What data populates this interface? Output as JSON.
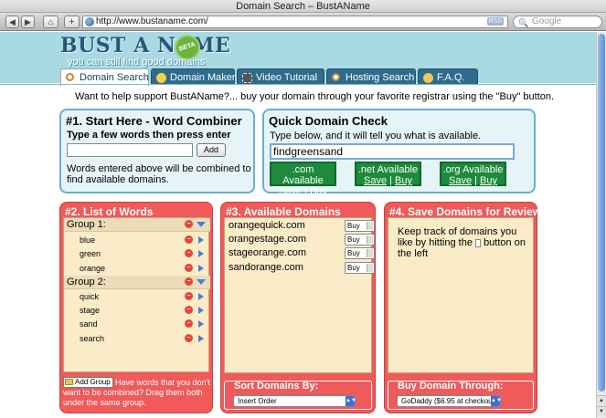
{
  "window": {
    "title": "Domain Search – BustAName"
  },
  "browser": {
    "url": "http://www.bustaname.com/",
    "rss_label": "RSS",
    "search_placeholder": "Google"
  },
  "site": {
    "logo_title": "BUST A NAME",
    "logo_badge": "BETA",
    "tagline": "you can still find good domains"
  },
  "tabs": [
    {
      "label": "Domain Search",
      "active": true,
      "icon": "magnifier-icon"
    },
    {
      "label": "Domain Maker",
      "active": false,
      "icon": "lightbulb-icon"
    },
    {
      "label": "Video Tutorial",
      "active": false,
      "icon": "film-icon"
    },
    {
      "label": "Hosting Search",
      "active": false,
      "icon": "magnifier-icon"
    },
    {
      "label": "F.A.Q.",
      "active": false,
      "icon": "help-icon"
    }
  ],
  "support_text": "Want to help support BustAName?... buy your domain through your favorite registrar using the \"Buy\" button.",
  "combiner": {
    "title": "#1. Start Here - Word Combiner",
    "subtitle": "Type a few words then press enter",
    "input_value": "",
    "add_label": "Add",
    "note": "Words entered above will be combined to find available domains."
  },
  "quick_check": {
    "title": "Quick Domain Check",
    "subtitle": "Type below, and it will tell you what is available.",
    "input_value": "findgreensand",
    "results": [
      {
        "label": ".com Available",
        "save": "Save",
        "sep": "|",
        "buy": "Buy"
      },
      {
        "label": ".net Available",
        "save": "Save",
        "sep": "|",
        "buy": "Buy"
      },
      {
        "label": ".org Available",
        "save": "Save",
        "sep": "|",
        "buy": "Buy"
      }
    ]
  },
  "word_list": {
    "title": "#2. List of Words",
    "groups": [
      {
        "name": "Group 1:",
        "words": [
          "blue",
          "green",
          "orange"
        ]
      },
      {
        "name": "Group 2:",
        "words": [
          "quick",
          "stage",
          "sand",
          "search"
        ]
      }
    ],
    "add_group_label": "Add Group",
    "note": "Have words that you don't want to be combined? Drag them both under the same group."
  },
  "available": {
    "title": "#3. Available Domains",
    "domains": [
      "orangequick.com",
      "orangestage.com",
      "stageorange.com",
      "sandorange.com"
    ],
    "buy_label": "Buy",
    "sort_title": "Sort Domains By:",
    "sort_value": "Insert Order"
  },
  "saved": {
    "title": "#4. Save Domains for Review",
    "text_before": "Keep track of domains you like by hitting the",
    "text_after": "button on the left",
    "buy_title": "Buy Domain Through:",
    "buy_value": "GoDaddy ($6.95 at checkout)"
  },
  "colors": {
    "header_bg": "#a9dae4",
    "tab_bg": "#2e6b8d",
    "panel_blue": "#e6f4f8",
    "panel_red": "#ef5a5a",
    "available_green": "#1d8a3c"
  }
}
